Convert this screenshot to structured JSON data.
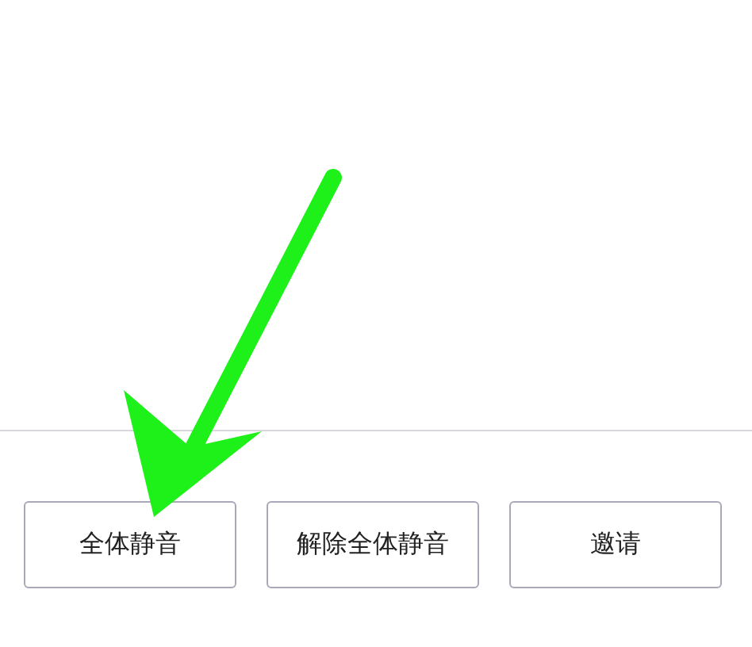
{
  "buttons": [
    {
      "label": "全体静音"
    },
    {
      "label": "解除全体静音"
    },
    {
      "label": "邀请"
    }
  ]
}
